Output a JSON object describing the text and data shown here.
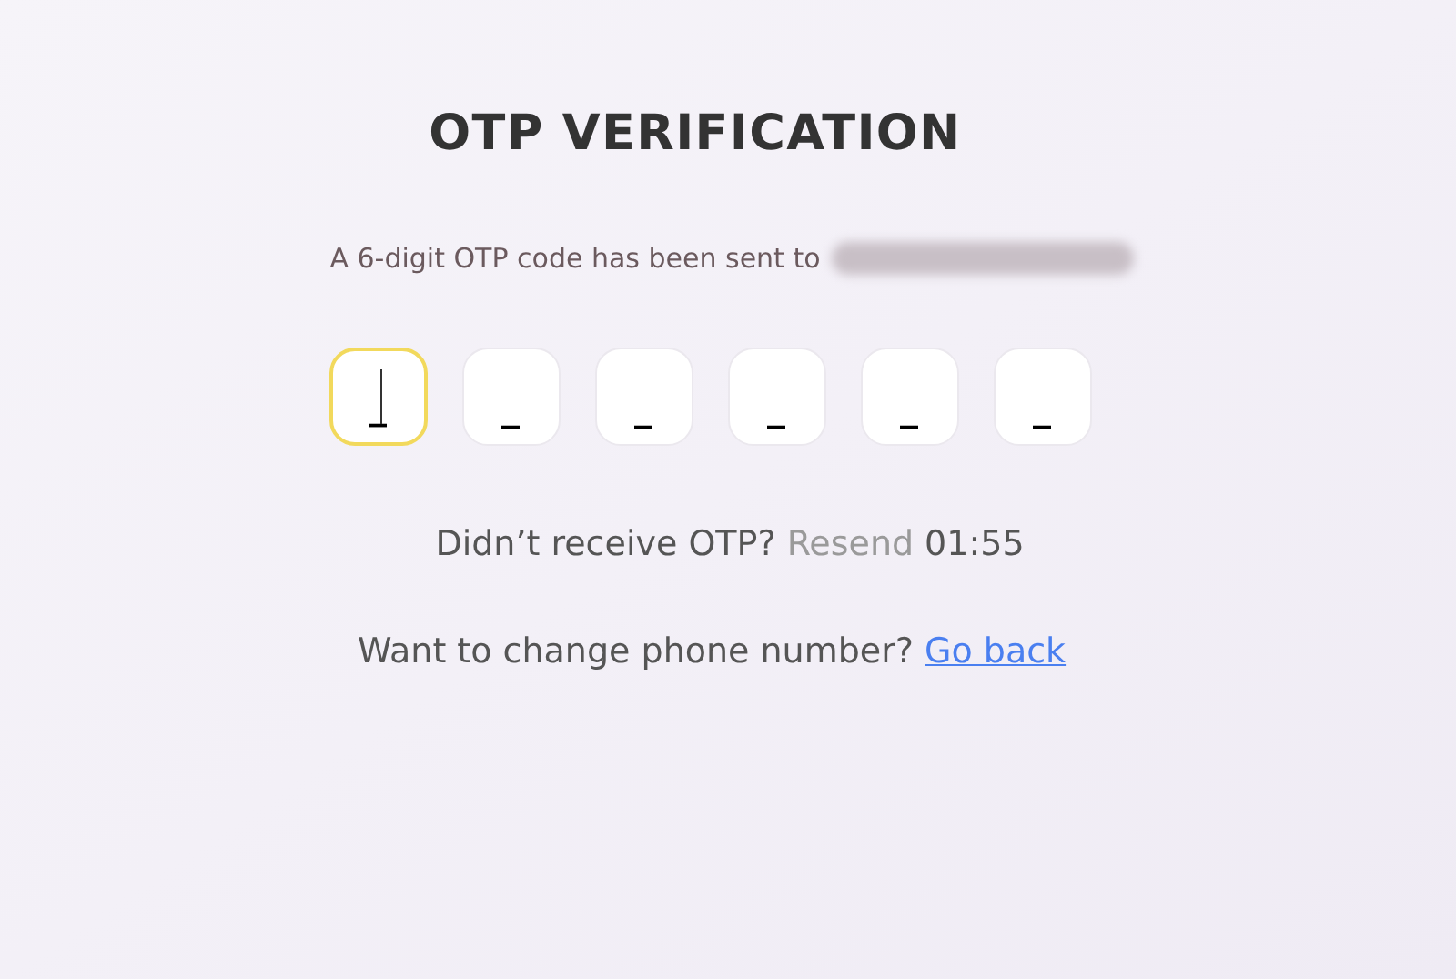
{
  "title": "OTP VERIFICATION",
  "message": "A 6-digit OTP code has been sent to",
  "phone_hidden": true,
  "otp_inputs": [
    {
      "placeholder": "_",
      "focused": true
    },
    {
      "placeholder": "_",
      "focused": false
    },
    {
      "placeholder": "_",
      "focused": false
    },
    {
      "placeholder": "_",
      "focused": false
    },
    {
      "placeholder": "_",
      "focused": false
    },
    {
      "placeholder": "_",
      "focused": false
    }
  ],
  "resend": {
    "prompt": "Didn’t receive OTP?",
    "button": "Resend",
    "disabled": true,
    "timer": "01:55"
  },
  "change": {
    "prompt": "Want to change phone number?",
    "link": "Go back"
  }
}
